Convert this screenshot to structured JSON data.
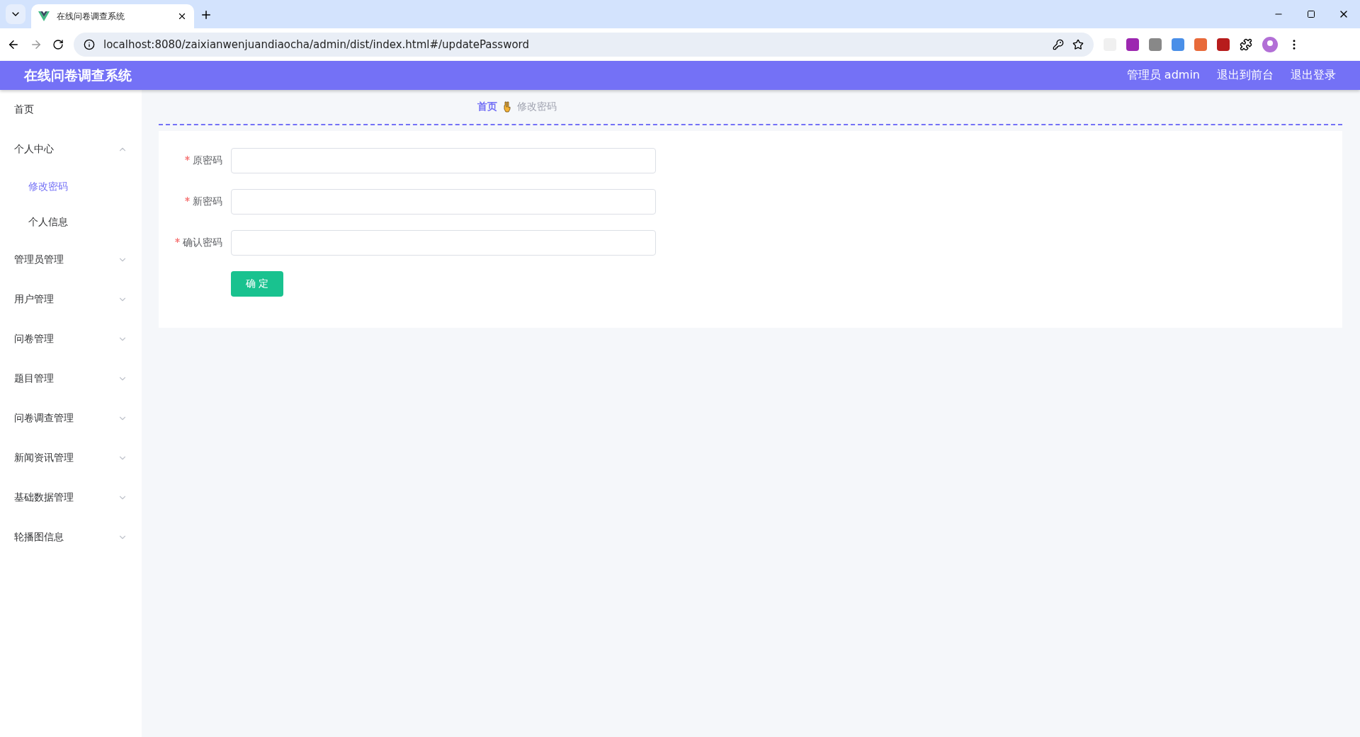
{
  "browser": {
    "tab_title": "在线问卷调查系统",
    "url": "localhost:8080/zaixianwenjuandiaocha/admin/dist/index.html#/updatePassword"
  },
  "header": {
    "title": "在线问卷调查系统",
    "user": "管理员 admin",
    "links": [
      "退出到前台",
      "退出登录"
    ]
  },
  "sidebar": {
    "items": [
      {
        "label": "首页",
        "selected": false
      },
      {
        "label": "个人中心",
        "expanded": true,
        "children": [
          {
            "label": "修改密码",
            "selected": true
          },
          {
            "label": "个人信息",
            "selected": false
          }
        ]
      },
      {
        "label": "管理员管理",
        "expanded": false
      },
      {
        "label": "用户管理",
        "expanded": false
      },
      {
        "label": "问卷管理",
        "expanded": false
      },
      {
        "label": "题目管理",
        "expanded": false
      },
      {
        "label": "问卷调查管理",
        "expanded": false
      },
      {
        "label": "新闻资讯管理",
        "expanded": false
      },
      {
        "label": "基础数据管理",
        "expanded": false
      },
      {
        "label": "轮播图信息",
        "expanded": false
      }
    ]
  },
  "breadcrumb": [
    "首页",
    "修改密码"
  ],
  "form": {
    "fields": [
      {
        "label": "原密码",
        "required": true
      },
      {
        "label": "新密码",
        "required": true
      },
      {
        "label": "确认密码",
        "required": true
      }
    ],
    "submit": "确 定"
  }
}
